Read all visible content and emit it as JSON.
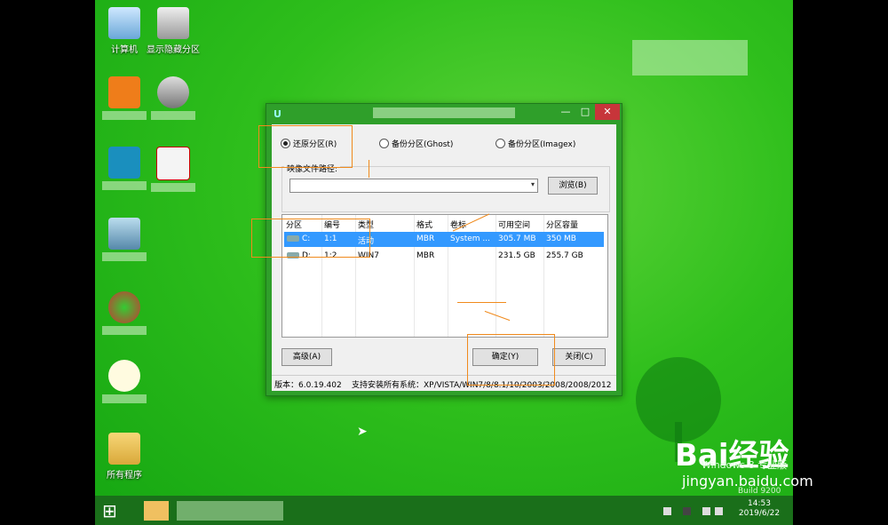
{
  "desktop": {
    "icons": [
      {
        "label": "计算机",
        "icon": "computer-icon"
      },
      {
        "label": "显示隐藏分区",
        "icon": "partition-icon"
      },
      {
        "label": "所有程序",
        "icon": "folder-icon"
      }
    ]
  },
  "dialog": {
    "radios": [
      {
        "label": "还原分区(R)",
        "checked": true
      },
      {
        "label": "备份分区(Ghost)",
        "checked": false
      },
      {
        "label": "备份分区(Imagex)",
        "checked": false
      }
    ],
    "image_path_label": "映像文件路径:",
    "image_path_value": "",
    "browse_label": "浏览(B)",
    "table": {
      "headers": [
        "分区",
        "编号",
        "类型",
        "格式",
        "卷标",
        "可用空间",
        "分区容量"
      ],
      "rows": [
        {
          "drive": "C:",
          "num": "1:1",
          "type": "活动",
          "format": "MBR",
          "label": "System ...",
          "free": "305.7 MB",
          "size": "350 MB",
          "selected": true
        },
        {
          "drive": "D:",
          "num": "1:2",
          "type": "WIN7",
          "format": "MBR",
          "label": "",
          "free": "231.5 GB",
          "size": "255.7 GB",
          "selected": false
        }
      ]
    },
    "advanced_label": "高级(A)",
    "ok_label": "确定(Y)",
    "close_label": "关闭(C)",
    "version": "版本：6.0.19.402",
    "supported_systems": "支持安装所有系统：XP/VISTA/WIN7/8/8.1/10/2003/2008/2008/2012"
  },
  "taskbar": {
    "time": "14:53",
    "date": "2019/6/22",
    "build": "Build 9200"
  },
  "watermark": {
    "logo": "Bai经验",
    "url": "jingyan.baidu.com",
    "edition": "Windows 8 专业版"
  },
  "colors": {
    "annotation": "#f08a1c",
    "selection": "#3399ff",
    "close_button": "#c7353a"
  }
}
